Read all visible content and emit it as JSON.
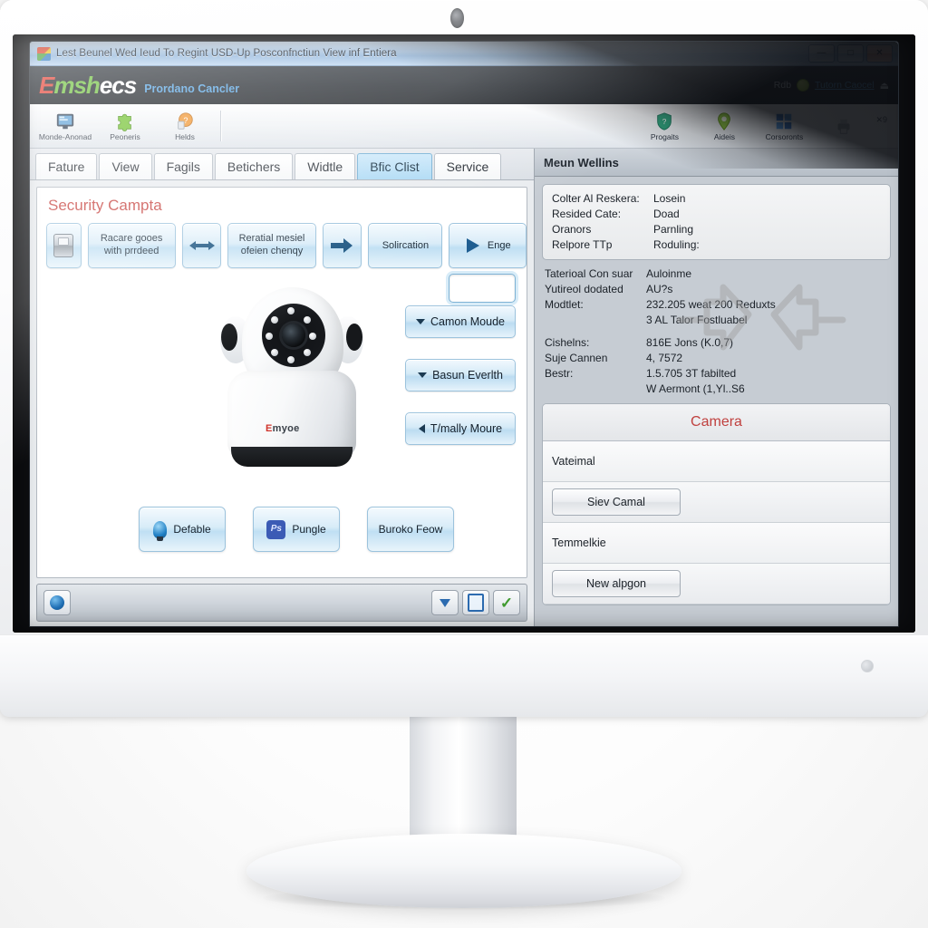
{
  "window": {
    "title": "Lest Beunel Wed Ieud To Regint USD-Up Posconfnctiun View inf Entiera",
    "icon": "windows-logo-icon",
    "minimize": "—",
    "maximize": "□",
    "close": "✕"
  },
  "brand": {
    "logo_e": "E",
    "logo_msh": "msh",
    "logo_ecs": "ecs",
    "subtitle": "Prordano Cancler",
    "status_text": "Rdb",
    "link": "Tutorn Caocel",
    "eject": "⏏"
  },
  "toolbar": {
    "items": [
      {
        "label": "Monde-Anonad",
        "icon": "monitor-icon"
      },
      {
        "label": "Peoneris",
        "icon": "puzzle-piece-icon"
      },
      {
        "label": "Helds",
        "icon": "help-circle-icon"
      }
    ],
    "right_items": [
      {
        "label": "Progaits",
        "icon": "shield-icon"
      },
      {
        "label": "Aideis",
        "icon": "location-pin-icon"
      },
      {
        "label": "Corsoronts",
        "icon": "windows-apps-icon"
      },
      {
        "label": "",
        "icon": "printer-icon"
      }
    ],
    "close_mark": "✕9"
  },
  "tabs": [
    {
      "label": "Fature",
      "active": false
    },
    {
      "label": "View",
      "active": false
    },
    {
      "label": "Fagils",
      "active": false
    },
    {
      "label": "Betichers",
      "active": false
    },
    {
      "label": "Widtle",
      "active": false
    },
    {
      "label": "Bfic Clist",
      "active": true
    },
    {
      "label": "Service",
      "active": false
    }
  ],
  "left_panel": {
    "section_title": "Security Campta",
    "section_title_color": "#c6403c",
    "toolbar_buttons": [
      {
        "label": "",
        "icon": "drive-icon"
      },
      {
        "label": "Racare gooes with prrdeed",
        "icon": ""
      },
      {
        "label": "",
        "icon": "left-right-arrow-icon"
      },
      {
        "label": "Reratial mesiel ofeien chenqy",
        "icon": ""
      },
      {
        "label": "",
        "icon": "right-arrow-icon"
      },
      {
        "label": "Solircation",
        "icon": ""
      },
      {
        "label": "Enge",
        "icon": "play-icon"
      }
    ],
    "input_value": "",
    "dropdowns": [
      {
        "label": "Camon Moude",
        "icon": "caret-down-icon"
      },
      {
        "label": "Basun Everlth",
        "icon": "caret-down-icon"
      },
      {
        "label": "T/mally Moure",
        "icon": "caret-left-icon"
      }
    ],
    "camera_brand_e": "E",
    "camera_brand_rest": "myoe",
    "bottom_buttons": [
      {
        "label": "Defable",
        "icon": "bulb-icon"
      },
      {
        "label": "Pungle",
        "icon": "photoshop-icon"
      },
      {
        "label": "Buroko Feow",
        "icon": ""
      }
    ]
  },
  "status_bar": {
    "left_icon": "globe-icon",
    "right_icons": [
      "download-icon",
      "book-icon",
      "checkmark-icon"
    ]
  },
  "right_panel": {
    "header": "Meun Wellins",
    "info_block_1": [
      {
        "key": "Colter Al Reskera:",
        "value": "Losein"
      },
      {
        "key": "Resided Cate:",
        "value": "Doad"
      },
      {
        "key": "Oranors",
        "value": "Parnling"
      },
      {
        "key": "Relpore TTp",
        "value": "Roduling:"
      }
    ],
    "info_block_2": [
      {
        "key": "Taterioal Con suar",
        "value": "Auloinme"
      },
      {
        "key": "Yutireol dodated",
        "value": "AU?s"
      },
      {
        "key": "Modtlet:",
        "value": "232.205 weat 200 Reduxts"
      },
      {
        "key": "",
        "value": "3 AL Talor Fostluabel"
      },
      {
        "key": "Cishelns:",
        "value": "816E Jons (K.0,7)"
      },
      {
        "key": "Suje Cannen",
        "value": "4, 7572"
      },
      {
        "key": "Bestr:",
        "value": "1.5.705 3T fabilted"
      },
      {
        "key": "",
        "value": "W Aermont (1,Yl..S6"
      }
    ],
    "camera_section": {
      "title": "Camera",
      "title_color": "#c0413f",
      "row_label_1": "Vateimal",
      "button_1": "Siev Camal",
      "row_label_2": "Temmelkie",
      "button_2": "New alpgon"
    },
    "overlay_arrows": "two-grey-arrows-icon"
  }
}
